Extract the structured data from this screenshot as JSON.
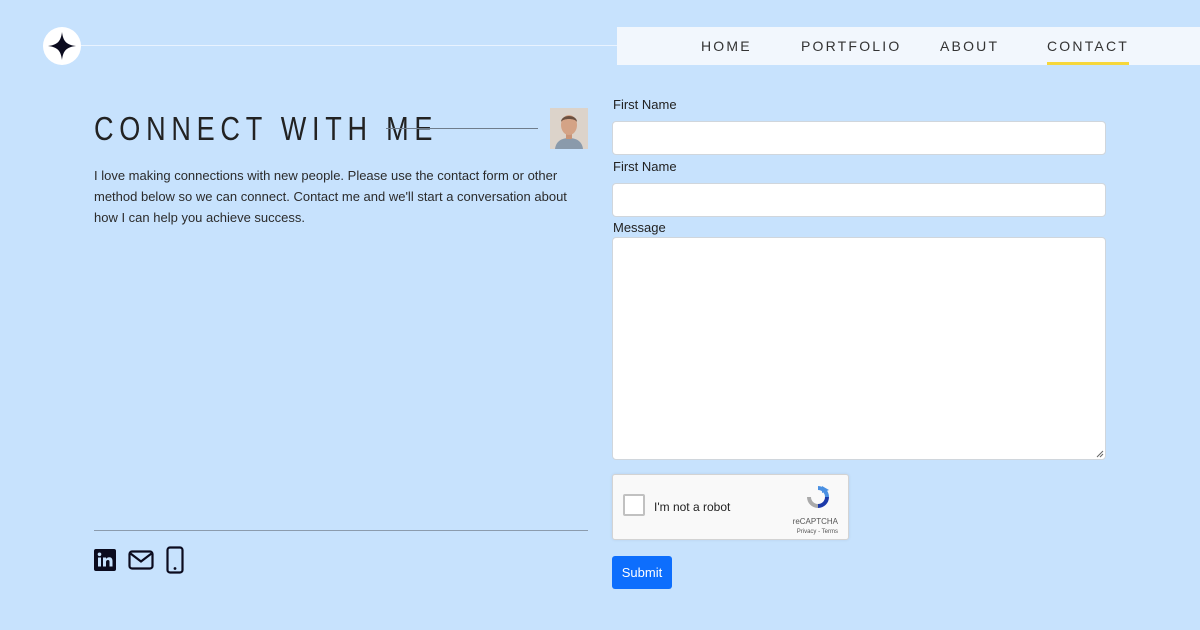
{
  "nav": {
    "items": [
      {
        "label": "HOME"
      },
      {
        "label": "PORTFOLIO"
      },
      {
        "label": "ABOUT"
      },
      {
        "label": "CONTACT",
        "active": true
      }
    ]
  },
  "hero": {
    "heading": "CONNECT WITH ME",
    "intro": "I love making connections with new people. Please use the contact form or other method below so we can connect. Contact me and we'll start a conversation about how I can help you achieve success."
  },
  "socials": [
    "linkedin-icon",
    "mail-icon",
    "phone-icon"
  ],
  "form": {
    "field1_label": "First Name",
    "field1_value": "",
    "field2_label": "First Name",
    "field2_value": "",
    "message_label": "Message",
    "message_value": "",
    "captcha_label": "I'm not a robot",
    "captcha_brand": "reCAPTCHA",
    "captcha_links": "Privacy - Terms",
    "submit_label": "Submit"
  },
  "colors": {
    "background": "#c7e2fd",
    "nav_active_underline": "#f6d73b",
    "submit": "#0d6efd"
  }
}
